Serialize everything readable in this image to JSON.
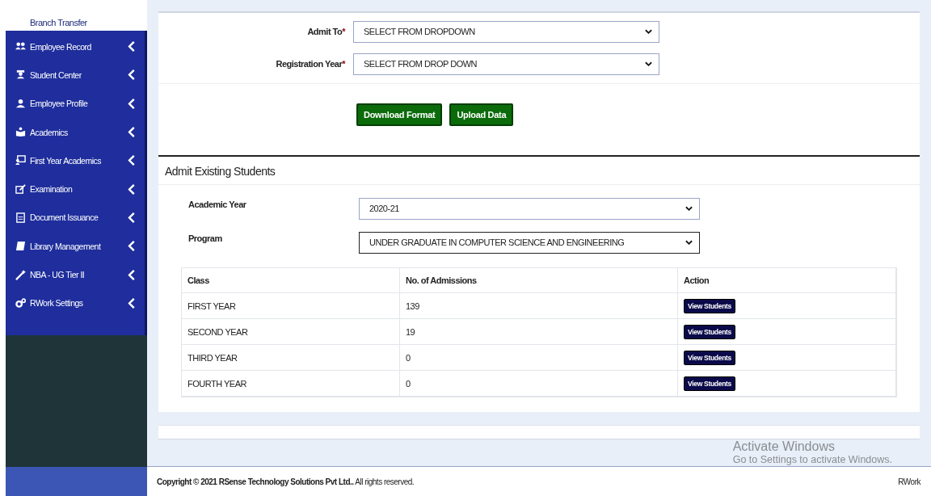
{
  "sidebar": {
    "header": "Branch Transfer",
    "items": [
      {
        "label": "Employee Record",
        "expanded": false
      },
      {
        "label": "Student Center",
        "expanded": false
      },
      {
        "label": "Employee Profile",
        "expanded": false
      },
      {
        "label": "Academics",
        "expanded": false
      },
      {
        "label": "First Year Academics",
        "expanded": false
      },
      {
        "label": "Examination",
        "expanded": false
      },
      {
        "label": "Document Issuance",
        "expanded": false
      },
      {
        "label": "Library Management",
        "expanded": false
      },
      {
        "label": "NBA - UG Tier II",
        "expanded": false
      },
      {
        "label": "RWork Settings",
        "expanded": false
      }
    ]
  },
  "upload_form": {
    "fields": [
      {
        "label": "Admit To",
        "required_mark": "*",
        "value": "SELECT FROM DROPDOWN"
      },
      {
        "label": "Registration Year",
        "required_mark": "*",
        "value": "SELECT FROM DROP DOWN"
      }
    ],
    "buttons": [
      "Download Format",
      "Upload Data"
    ]
  },
  "admit_existing": {
    "title": "Admit Existing Students",
    "fields": [
      {
        "label": "Academic Year",
        "value": "2020-21",
        "focused": false
      },
      {
        "label": "Program",
        "value": "UNDER GRADUATE IN COMPUTER SCIENCE AND ENGINEERING",
        "focused": true
      }
    ],
    "table": {
      "columns": [
        "Class",
        "No. of Admissions",
        "Action"
      ],
      "rows": [
        {
          "class": "FIRST YEAR",
          "admissions": "139",
          "action": "View Students"
        },
        {
          "class": "SECOND YEAR",
          "admissions": "19",
          "action": "View Students"
        },
        {
          "class": "THIRD YEAR",
          "admissions": "0",
          "action": "View Students"
        },
        {
          "class": "FOURTH YEAR",
          "admissions": "0",
          "action": "View Students"
        }
      ]
    }
  },
  "os_overlay": {
    "title": "Activate Windows",
    "subtitle": "Go to Settings to activate Windows."
  },
  "footer": {
    "copyright": "**Copyright © 2021 RSense Technology Solutions Pvt Ltd..** All rights reserved.",
    "brand": "RWork"
  }
}
